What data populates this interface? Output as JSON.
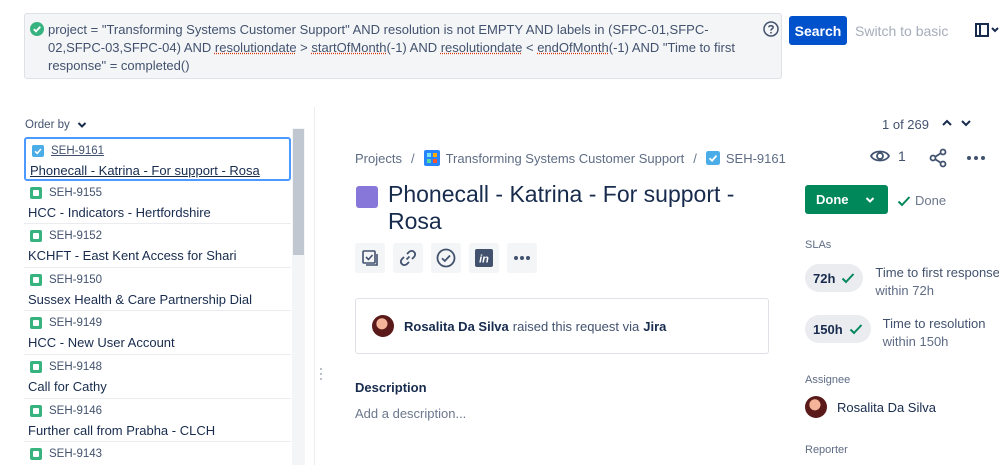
{
  "jql": {
    "text_parts": [
      "project = \"Transforming Systems Customer Support\" AND resolution is not EMPTY AND labels in (SFPC-01,SFPC-02,SFPC-03,SFPC-04) AND ",
      "resolutiondate",
      " > ",
      "startOfMonth",
      "(-1) AND ",
      "resolutiondate",
      " < ",
      "endOfMonth",
      "(-1) AND \"Time to first response\" = completed()"
    ]
  },
  "toolbar": {
    "search_label": "Search",
    "switch_label": "Switch to basic"
  },
  "list": {
    "order_by_label": "Order by",
    "items": [
      {
        "key": "SEH-9161",
        "summary": "Phonecall - Katrina - For support - Rosa"
      },
      {
        "key": "SEH-9155",
        "summary": "HCC - Indicators - Hertfordshire"
      },
      {
        "key": "SEH-9152",
        "summary": "KCHFT - East Kent Access for Shari"
      },
      {
        "key": "SEH-9150",
        "summary": "Sussex Health & Care Partnership Dial"
      },
      {
        "key": "SEH-9149",
        "summary": "HCC - New User Account"
      },
      {
        "key": "SEH-9148",
        "summary": "Call for Cathy"
      },
      {
        "key": "SEH-9146",
        "summary": "Further call from Prabha - CLCH"
      },
      {
        "key": "SEH-9143",
        "summary": ""
      }
    ]
  },
  "pager": {
    "text": "1 of 269"
  },
  "breadcrumb": {
    "projects": "Projects",
    "project_name": "Transforming Systems Customer Support",
    "issue_key": "SEH-9161"
  },
  "watchers": {
    "count": "1"
  },
  "issue": {
    "title": "Phonecall - Katrina - For support - Rosa",
    "request_name": "Rosalita Da Silva",
    "request_mid": "raised this request via",
    "request_via": "Jira",
    "description_label": "Description",
    "description_placeholder": "Add a description..."
  },
  "side": {
    "status_label": "Done",
    "resolution_label": "Done",
    "sla_label": "SLAs",
    "slas": [
      {
        "value": "72h",
        "name": "Time to first response",
        "sub": "within 72h"
      },
      {
        "value": "150h",
        "name": "Time to resolution",
        "sub": "within 150h"
      }
    ],
    "assignee_label": "Assignee",
    "assignee_name": "Rosalita Da Silva",
    "reporter_label": "Reporter"
  },
  "colors": {
    "primary": "#0052CC",
    "done_green": "#00875A",
    "selected_border": "#4C9AFF",
    "story_icon": "#36B37E",
    "task_icon": "#4BADE8",
    "purple_type": "#8777D9"
  }
}
